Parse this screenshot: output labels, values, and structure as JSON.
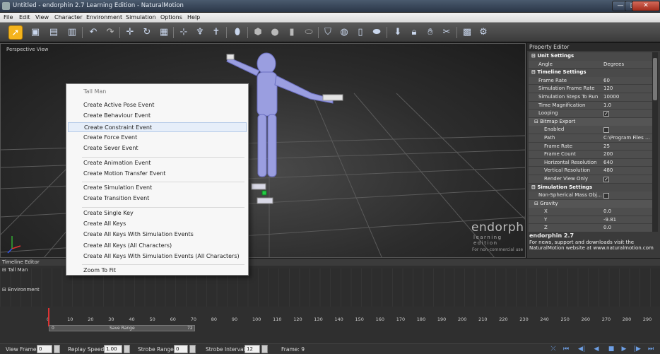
{
  "window": {
    "title": "Untitled - endorphin 2.7 Learning Edition - NaturalMotion"
  },
  "menu": [
    "File",
    "Edit",
    "View",
    "Character",
    "Environment",
    "Simulation",
    "Options",
    "Help"
  ],
  "viewport": {
    "label": "Perspective View",
    "watermark": "endorphin",
    "watermark_sub": "learning edition",
    "watermark_note": "For non-commercial use"
  },
  "context_menu": {
    "header": "Tall Man",
    "groups": [
      [
        "Create Active Pose Event",
        "Create Behaviour Event",
        "Create Constraint Event",
        "Create Force Event",
        "Create Sever Event"
      ],
      [
        "Create Animation Event",
        "Create Motion Transfer Event"
      ],
      [
        "Create Simulation Event",
        "Create Transition Event"
      ],
      [
        "Create Single Key",
        "Create All Keys",
        "Create All Keys With Simulation Events",
        "Create All Keys (All Characters)",
        "Create All Keys With Simulation Events (All Characters)"
      ],
      [
        "Zoom To Fit"
      ]
    ],
    "hovered": "Create Constraint Event"
  },
  "property_editor": {
    "title": "Property Editor",
    "unit_settings": "Unit Settings",
    "angle_label": "Angle",
    "angle_value": "Degrees",
    "timeline_settings": "Timeline Settings",
    "frame_rate_label": "Frame Rate",
    "frame_rate_value": "60",
    "sim_frame_rate_label": "Simulation Frame Rate",
    "sim_frame_rate_value": "120",
    "sim_steps_label": "Simulation Steps To Run",
    "sim_steps_value": "10000",
    "time_mag_label": "Time Magnification",
    "time_mag_value": "1.0",
    "looping_label": "Looping",
    "looping_checked": true,
    "bitmap_export": "Bitmap Export",
    "enabled_label": "Enabled",
    "enabled_checked": false,
    "path_label": "Path",
    "path_value": "C:\\Program Files ...",
    "bm_frame_rate_label": "Frame Rate",
    "bm_frame_rate_value": "25",
    "frame_count_label": "Frame Count",
    "frame_count_value": "200",
    "h_res_label": "Horizontal Resolution",
    "h_res_value": "640",
    "v_res_label": "Vertical Resolution",
    "v_res_value": "480",
    "render_view_label": "Render View Only",
    "render_view_checked": true,
    "simulation_settings": "Simulation Settings",
    "nonspherical_label": "Non-Spherical Mass Obj...",
    "nonspherical_checked": false,
    "gravity": "Gravity",
    "gx_label": "X",
    "gx_value": "0.0",
    "gy_label": "Y",
    "gy_value": "-9.81",
    "gz_label": "Z",
    "gz_value": "0.0",
    "info_title": "endorphin 2.7",
    "info_text": "For news, support and downloads visit the NaturalMotion website at www.naturalmotion.com"
  },
  "timeline": {
    "title": "Timeline Editor",
    "track_character": "Tall Man",
    "track_environment": "Environment",
    "ticks": [
      "0",
      "10",
      "20",
      "30",
      "40",
      "50",
      "60",
      "70",
      "80",
      "90",
      "100",
      "110",
      "120",
      "130",
      "140",
      "150",
      "160",
      "170",
      "180",
      "190",
      "200",
      "210",
      "220",
      "230",
      "240",
      "250",
      "260",
      "270",
      "280",
      "290"
    ],
    "save_range_label": "Save Range",
    "save_range_start": "0",
    "save_range_end": "72"
  },
  "status": {
    "view_frame_label": "View Frame:",
    "view_frame_value": "0",
    "replay_speed_label": "Replay Speed:",
    "replay_speed_value": "1.00",
    "strobe_range_label": "Strobe Range:",
    "strobe_range_value": "0",
    "strobe_interval_label": "Strobe Interval:",
    "strobe_interval_value": "12",
    "frame_label": "Frame: 9"
  },
  "colors": {
    "accent": "#f4b31c",
    "figure": "#9a9ee0",
    "highlight": "#e6eef9"
  }
}
